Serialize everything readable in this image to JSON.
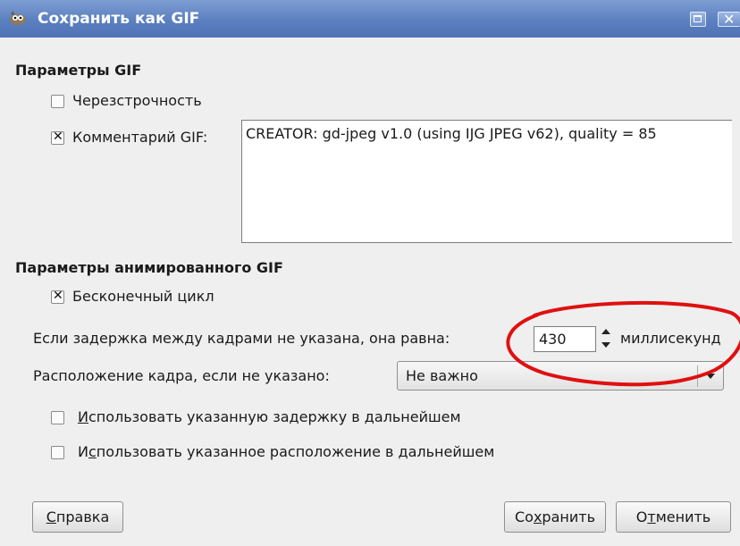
{
  "window": {
    "title": "Сохранить как GIF",
    "app_icon": "gimp-wilber-icon",
    "maximize_icon": "maximize-icon",
    "close_glyph": "✕"
  },
  "gif_params": {
    "section_title": "Параметры GIF",
    "interlace": {
      "label": "Черезстрочность",
      "checked": false
    },
    "comment": {
      "label": "Комментарий GIF:",
      "checked": true,
      "value": "CREATOR: gd-jpeg v1.0 (using IJG JPEG v62), quality = 85"
    }
  },
  "anim_params": {
    "section_title": "Параметры анимированного GIF",
    "loop": {
      "label": "Бесконечный цикл",
      "checked": true
    },
    "delay": {
      "label": "Если задержка между кадрами не указана, она равна:",
      "value": "430",
      "unit": "миллисекунд"
    },
    "disposal": {
      "label": "Расположение кадра, если не указано:",
      "selected": "Не важно"
    },
    "use_delay": {
      "label_mnemonic": "И",
      "label_rest": "спользовать указанную задержку в дальнейшем",
      "checked": false
    },
    "use_disposal": {
      "label_pre": "И",
      "label_mnemonic": "с",
      "label_rest": "пользовать указанное расположение в дальнейшем",
      "checked": false
    }
  },
  "buttons": {
    "help": {
      "mnemonic": "С",
      "rest": "правка"
    },
    "save": {
      "pre": "Со",
      "mnemonic": "х",
      "rest": "ранить"
    },
    "cancel": {
      "pre": "О",
      "mnemonic": "т",
      "rest": "менить"
    }
  },
  "annotation": {
    "color": "#e01010"
  }
}
